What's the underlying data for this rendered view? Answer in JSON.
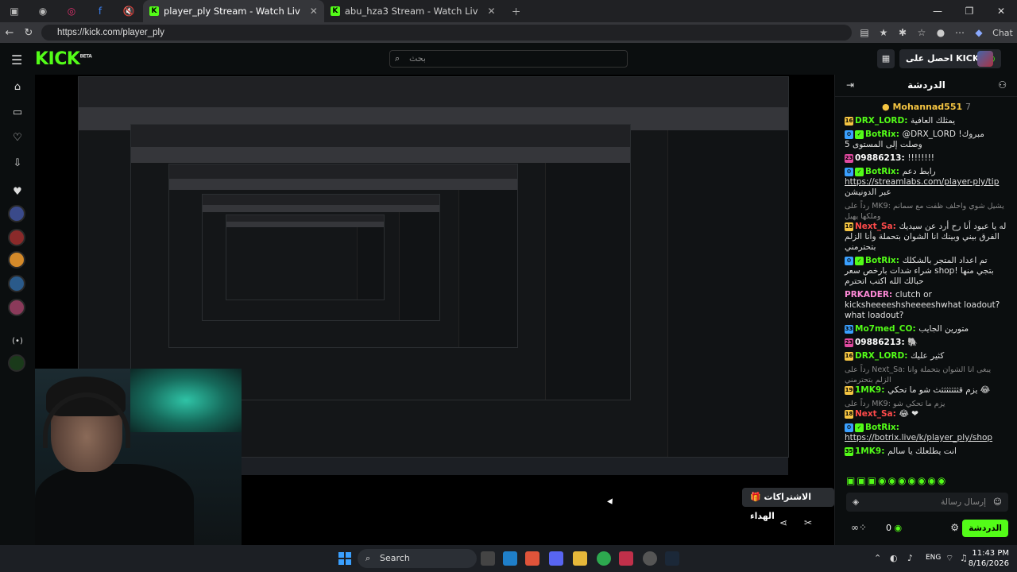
{
  "browser": {
    "tabs": [
      {
        "label": "player_ply Stream - Watch Liv",
        "active": true
      },
      {
        "label": "abu_hza3 Stream - Watch Liv",
        "active": false
      }
    ],
    "url": "https://kick.com/player_ply",
    "profile_label": "Chat"
  },
  "header": {
    "logo": "KICK",
    "logo_sup": "BETA",
    "search_placeholder": "بحث",
    "get_kicks": "احصل على KICKs"
  },
  "stream": {
    "tooltip": "الاشتراكات الهداء"
  },
  "chat": {
    "title": "الدردشة",
    "pinned_user": "Mohannad551",
    "pinned_count": "7",
    "messages": [
      {
        "badge": "16",
        "badge_color": "#f5c542",
        "user": "DRX_LORD",
        "user_color": "#53fc18",
        "text": "يمثلك العافية"
      },
      {
        "badge": "bot",
        "badge_color": "#3aa0ff",
        "user": "BotRix",
        "user_color": "#53fc18",
        "text": "@DRX_LORD مبروك! وصلت إلى المستوى 5"
      },
      {
        "badge": "23",
        "badge_color": "#e04aa0",
        "user": "09886213",
        "user_color": "#fff",
        "text": "!!!!!!!!"
      },
      {
        "badge": "bot",
        "badge_color": "#3aa0ff",
        "user": "BotRix",
        "user_color": "#53fc18",
        "text": "رابط دعم",
        "link": "https://streamlabs.com/player-ply/tip",
        "text2": "عبر الدونيشن"
      },
      {
        "reply": "رداً على MK9: يشيل شوي واحلف ظفت مع سمانم وملكها يهيل",
        "badge": "18",
        "badge_color": "#f5c542",
        "user": "Next_Sa",
        "user_color": "#ff4a4a",
        "text": "له يا عبود أنا رح أرد عن سيديك الفرق بيني وبينك انا الشوان بتحملة وأنا الزلم بتحترمني"
      },
      {
        "badge": "bot",
        "badge_color": "#3aa0ff",
        "user": "BotRix",
        "user_color": "#53fc18",
        "text": "تم اعداد المتجر بالشكلك شراء شدات بارخص سعر shop! بتجي منها حبالك الله اكتب اتحترم"
      },
      {
        "user": "PRKADER",
        "user_color": "#ff8ad8",
        "text": "clutch or kicksheeeeshsheeeeshwhat loadout?what loadout?"
      },
      {
        "badge": "33",
        "badge_color": "#3aa0ff",
        "user": "Mo7med_CO",
        "user_color": "#53fc18",
        "text": "متورين الجايب"
      },
      {
        "badge": "23",
        "badge_color": "#e04aa0",
        "user": "09886213",
        "user_color": "#fff",
        "text": "🐘"
      },
      {
        "badge": "16",
        "badge_color": "#f5c542",
        "user": "DRX_LORD",
        "user_color": "#53fc18",
        "text": "كثير عليك"
      },
      {
        "reply": "رداً على Next_Sa: يبغى انا الشوان بتحملة وانا الزلم بتحترمني",
        "badge": "19",
        "badge_color": "#f5c542",
        "user": "1MK9",
        "user_color": "#53fc18",
        "text": "يزم قثثثثثثثث شو ما تحكي 😂"
      },
      {
        "reply": "رداً على MK9: يزم ما تحكي شو",
        "badge": "18",
        "badge_color": "#f5c542",
        "user": "Next_Sa",
        "user_color": "#ff4a4a",
        "text": "😂 ❤"
      },
      {
        "badge": "bot",
        "badge_color": "#3aa0ff",
        "user": "BotRix",
        "user_color": "#53fc18",
        "link": "https://botrix.live/k/player_ply/shop"
      },
      {
        "badge": "35",
        "badge_color": "#53fc18",
        "user": "1MK9",
        "user_color": "#53fc18",
        "text": "انت يطلعلك يا سالم"
      }
    ],
    "input_placeholder": "إرسال رسالة",
    "kicks_count": "0",
    "send_label": "الدردشة"
  },
  "taskbar": {
    "search_label": "Search",
    "lang": "ENG",
    "time": "11:43 PM",
    "date": "8/16/2026"
  }
}
